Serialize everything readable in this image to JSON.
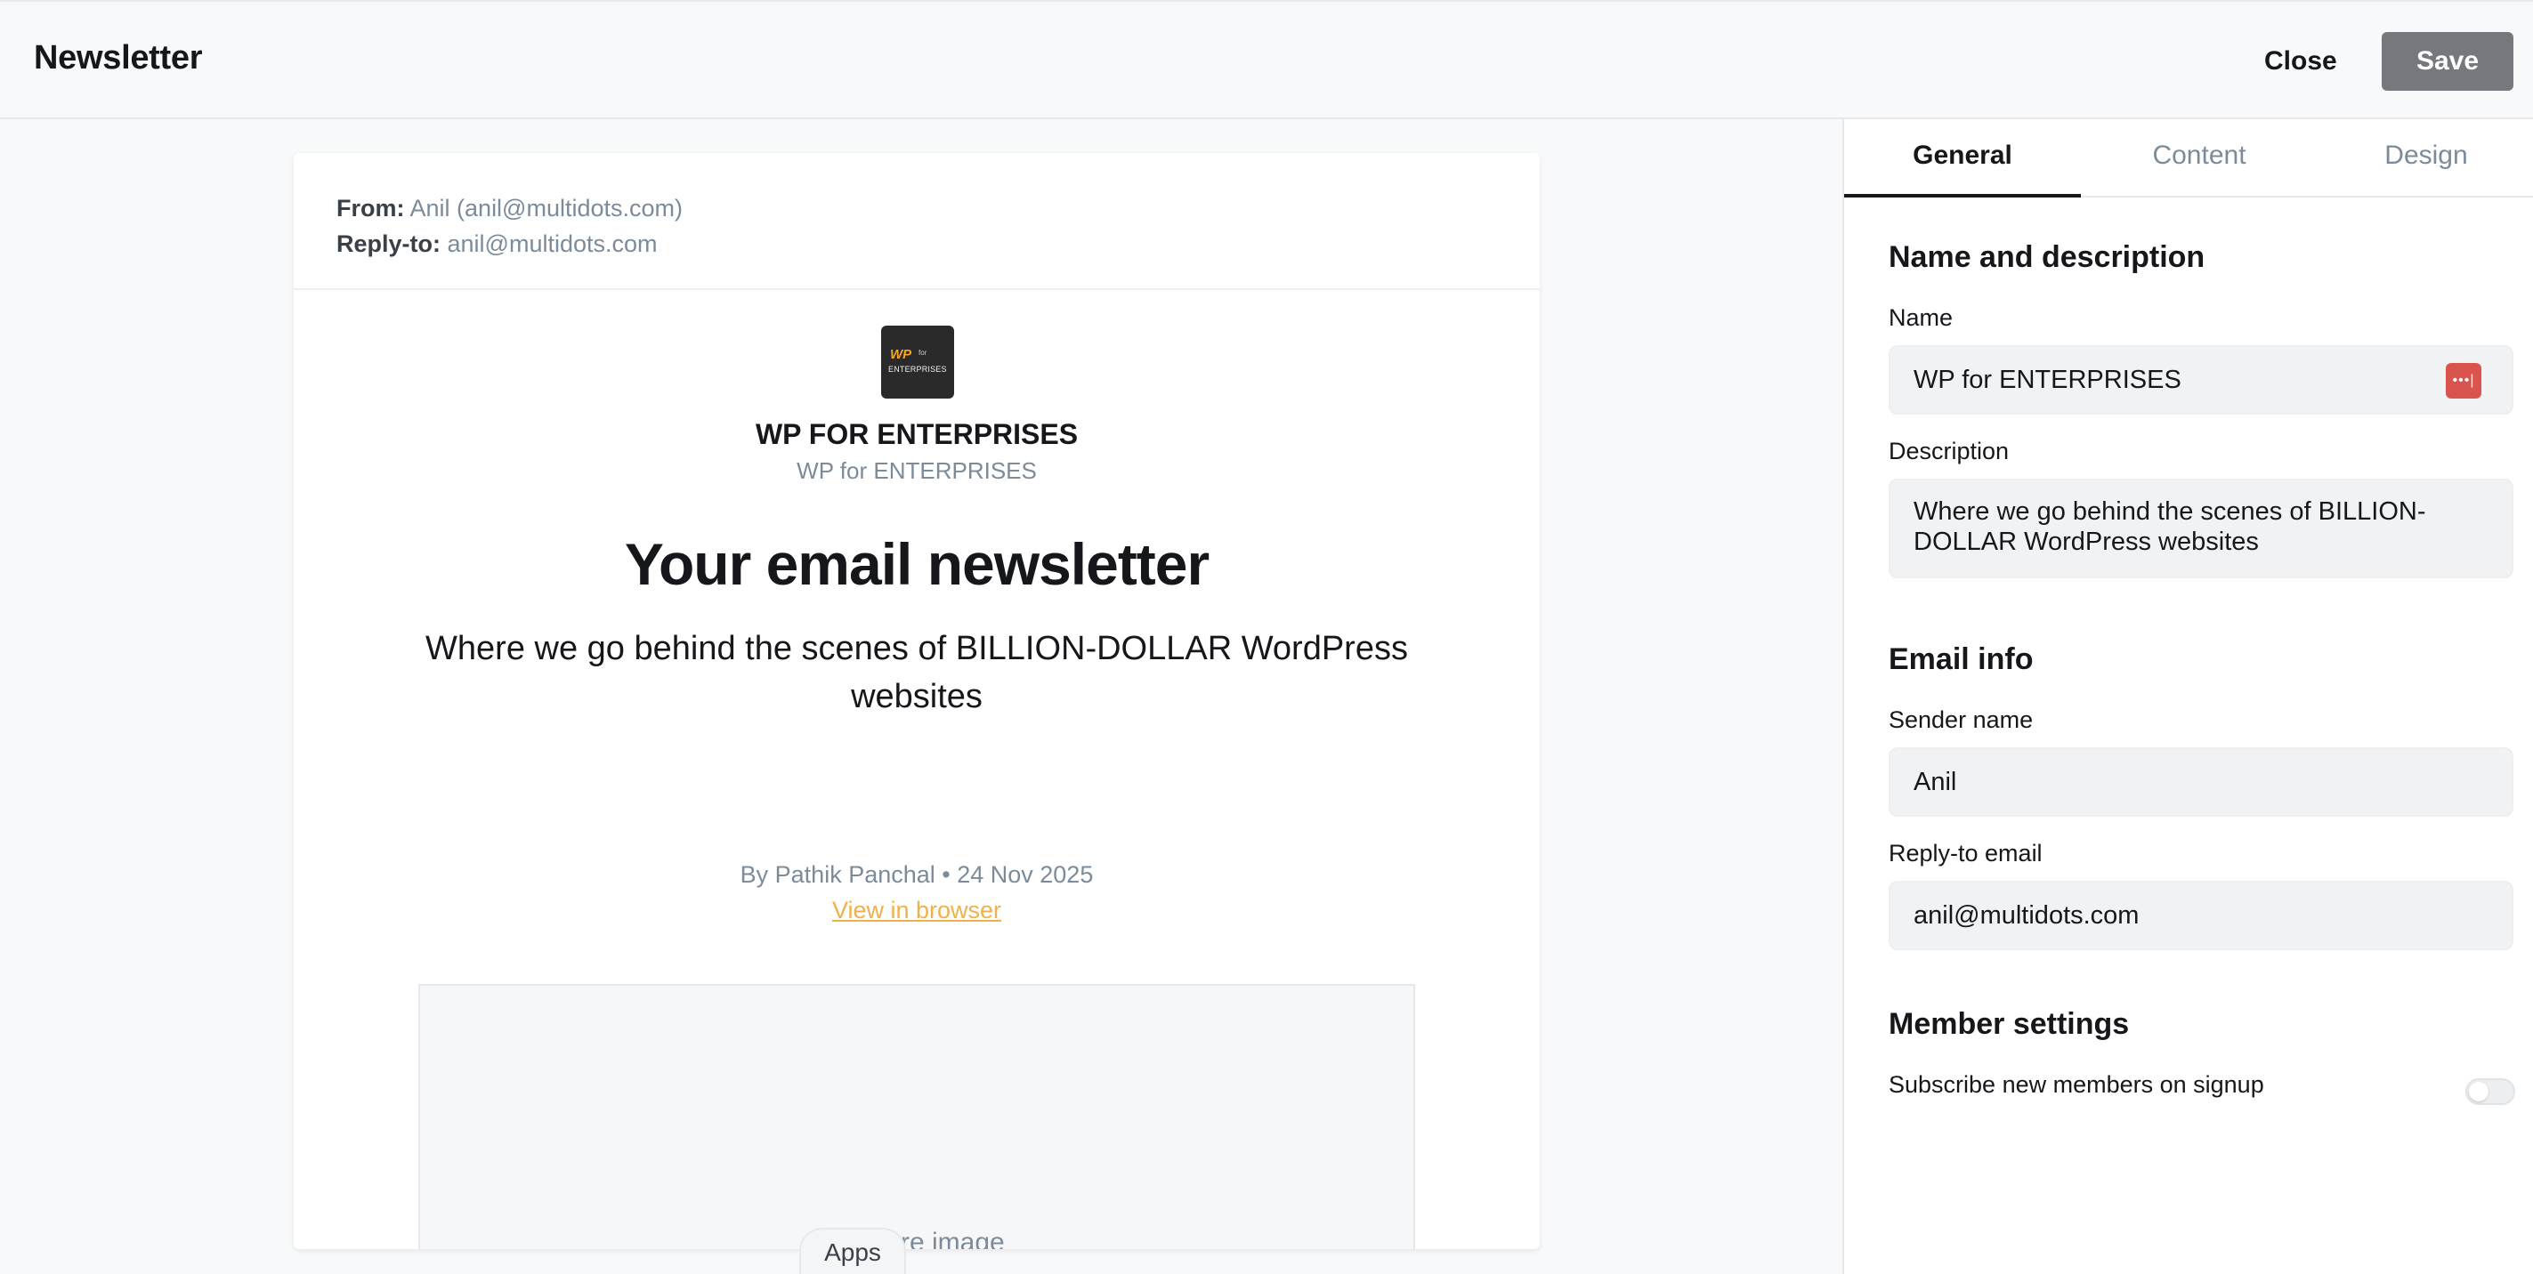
{
  "header": {
    "title": "Newsletter",
    "close_label": "Close",
    "save_label": "Save",
    "save_color": "#75787d"
  },
  "email_preview": {
    "from_label": "From:",
    "from_value": "Anil (anil@multidots.com)",
    "reply_to_label": "Reply-to:",
    "reply_to_value": "anil@multidots.com",
    "logo_text": "WP for ENTERPRISES",
    "publication_name": "WP FOR ENTERPRISES",
    "publication_subtitle": "WP for ENTERPRISES",
    "headline": "Your email newsletter",
    "subheadline": "Where we go behind the scenes of BILLION-DOLLAR WordPress websites",
    "byline": "By Pathik Panchal • 24 Nov 2025",
    "view_in_browser": "View in browser",
    "link_color": "#f0b04c",
    "feature_image_label": "Feature image"
  },
  "apps_button": "Apps",
  "settings_panel": {
    "tabs": [
      {
        "label": "General",
        "active": true
      },
      {
        "label": "Content",
        "active": false
      },
      {
        "label": "Design",
        "active": false
      }
    ],
    "name_section": {
      "title": "Name and description",
      "name_label": "Name",
      "name_value": "WP for ENTERPRISES",
      "description_label": "Description",
      "description_value": "Where we go behind the scenes of BILLION-DOLLAR WordPress websites"
    },
    "email_info": {
      "title": "Email info",
      "sender_label": "Sender name",
      "sender_value": "Anil",
      "reply_label": "Reply-to email",
      "reply_value": "anil@multidots.com"
    },
    "member_settings": {
      "title": "Member settings",
      "subscribe_label": "Subscribe new members on signup",
      "subscribe_enabled": false
    }
  }
}
